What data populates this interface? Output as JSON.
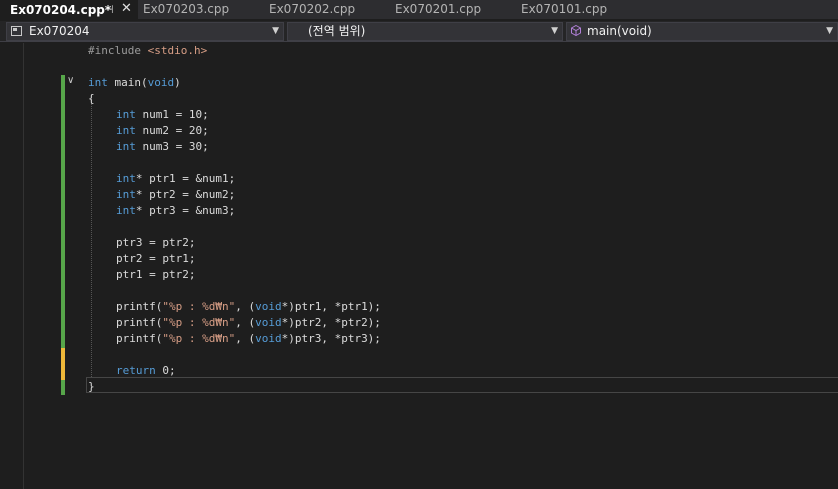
{
  "tabs": [
    {
      "label": "Ex070204.cpp*",
      "active": true
    },
    {
      "label": "Ex070203.cpp",
      "active": false
    },
    {
      "label": "Ex070202.cpp",
      "active": false
    },
    {
      "label": "Ex070201.cpp",
      "active": false
    },
    {
      "label": "Ex070101.cpp",
      "active": false
    }
  ],
  "tab_icons": {
    "pin": "pin-icon",
    "close": "close-icon"
  },
  "navbar": {
    "project": "Ex070204",
    "scope": "(전역 범위)",
    "member": "main(void)"
  },
  "code": {
    "l1_hash": "#include ",
    "l1_header": "<stdio.h>",
    "l3_int": "int",
    "l3_main": " main(",
    "l3_void": "void",
    "l3_close": ")",
    "l4": "{",
    "l5_int": "int",
    "l5_rest": " num1 = 10;",
    "l6_int": "int",
    "l6_rest": " num2 = 20;",
    "l7_int": "int",
    "l7_rest": " num3 = 30;",
    "l9_int": "int",
    "l9_rest": "* ptr1 = &num1;",
    "l10_int": "int",
    "l10_rest": "* ptr2 = &num2;",
    "l11_int": "int",
    "l11_rest": "* ptr3 = &num3;",
    "l13": "ptr3 = ptr2;",
    "l14": "ptr2 = ptr1;",
    "l15": "ptr1 = ptr2;",
    "p1_fn": "printf(",
    "p1_str": "\"%p : %d₩n\"",
    "p1_mid": ", (",
    "p1_void": "void",
    "p1_rest": "*)ptr1, *ptr1);",
    "p2_fn": "printf(",
    "p2_str": "\"%p : %d₩n\"",
    "p2_mid": ", (",
    "p2_void": "void",
    "p2_rest": "*)ptr2, *ptr2);",
    "p3_fn": "printf(",
    "p3_str": "\"%p : %d₩n\"",
    "p3_mid": ", (",
    "p3_void": "void",
    "p3_rest": "*)ptr3, *ptr3);",
    "ret_kw": "return",
    "ret_rest": " 0;",
    "close": "}"
  },
  "colors": {
    "keyword": "#569cd6",
    "string": "#d69d85",
    "change_saved": "#57a64a",
    "change_unsaved": "#efb839"
  }
}
